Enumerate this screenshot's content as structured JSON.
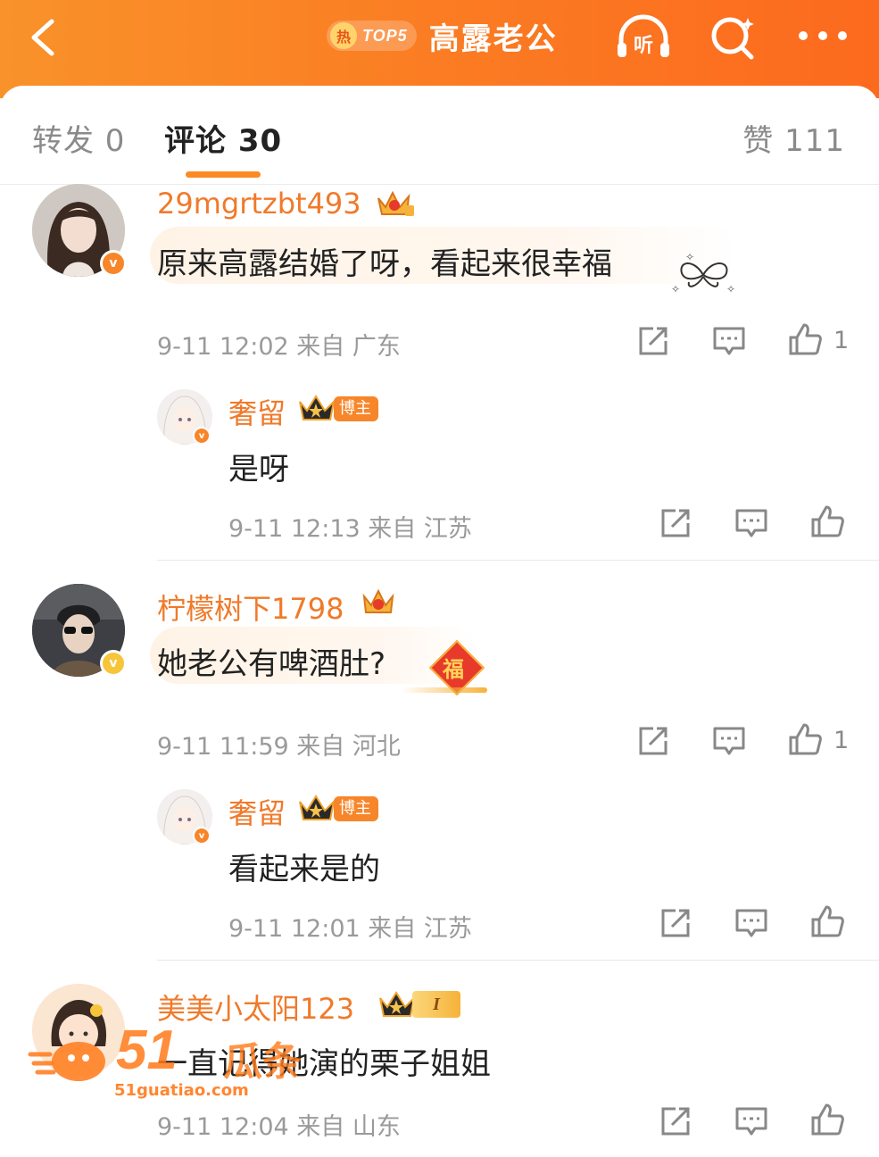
{
  "header": {
    "hot_badge_icon": "热",
    "hot_rank": "TOP5",
    "title": "高露老公",
    "listen_label": "听",
    "accent": "#fb7a22"
  },
  "tabs": {
    "repost": "转发 0",
    "comments": "评论 30",
    "likes": "赞 111"
  },
  "comments": [
    {
      "user": "29mgrtzbt493",
      "text": "原来高露结婚了呀，看起来很幸福",
      "meta": "9-11 12:02 来自 广东",
      "like_count": "1",
      "reply": {
        "user": "奢留",
        "badge": "博主",
        "text": "是呀",
        "meta": "9-11 12:13 来自 江苏"
      }
    },
    {
      "user": "柠檬树下1798",
      "text": "她老公有啤酒肚?",
      "meta": "9-11 11:59 来自 河北",
      "like_count": "1",
      "sticker": "福",
      "reply": {
        "user": "奢留",
        "badge": "博主",
        "text": "看起来是的",
        "meta": "9-11 12:01 来自 江苏"
      }
    },
    {
      "user": "美美小太阳123",
      "level": "I",
      "text": "一直记得她演的栗子姐姐",
      "meta": "9-11 12:04 来自 山东"
    }
  ],
  "watermark": {
    "number": "51",
    "brand": "瓜条",
    "url": "51guatiao.com"
  }
}
